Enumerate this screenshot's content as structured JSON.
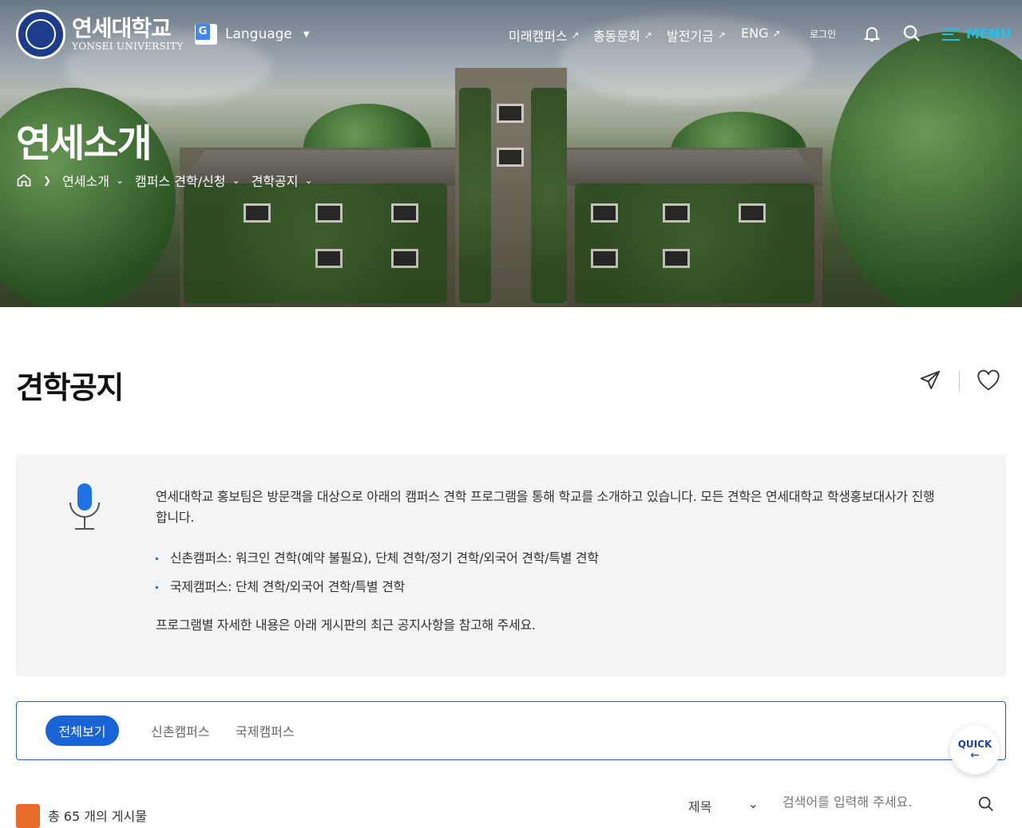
{
  "header": {
    "logo_ko": "연세대학교",
    "logo_en": "YONSEI UNIVERSITY",
    "language_label": "Language",
    "nav": [
      {
        "label": "미래캠퍼스"
      },
      {
        "label": "총동문회"
      },
      {
        "label": "발전기금"
      },
      {
        "label": "ENG"
      }
    ],
    "login_label": "로그인",
    "menu_label": "MENU"
  },
  "hero": {
    "title": "연세소개",
    "breadcrumb": [
      {
        "label": "연세소개"
      },
      {
        "label": "캠퍼스 견학/신청"
      },
      {
        "label": "견학공지"
      }
    ]
  },
  "page": {
    "title": "견학공지"
  },
  "info": {
    "intro": "연세대학교 홍보팀은 방문객을 대상으로 아래의 캠퍼스 견학 프로그램을 통해 학교를 소개하고 있습니다. 모든 견학은 연세대학교 학생홍보대사가 진행합니다.",
    "bullets": [
      "신촌캠퍼스: 워크인 견학(예약 불필요), 단체 견학/정기 견학/외국어 견학/특별 견학",
      "국제캠퍼스: 단체 견학/외국어 견학/특별 견학"
    ],
    "footer": "프로그램별 자세한 내용은 아래 게시판의 최근 공지사항을 참고해 주세요."
  },
  "tabs": [
    {
      "label": "전체보기",
      "active": true
    },
    {
      "label": "신촌캠퍼스",
      "active": false
    },
    {
      "label": "국제캠퍼스",
      "active": false
    }
  ],
  "quick": {
    "label": "QUICK",
    "arrow": "←"
  },
  "board": {
    "total_text": "총 65 개의 게시물",
    "search_field": "제목",
    "search_placeholder": "검색어를 입력해 주세요."
  },
  "colors": {
    "accent": "#1a63d6",
    "menu": "#21c0e6",
    "rss": "#e86a2a",
    "info_bg": "#f3f4f6"
  }
}
